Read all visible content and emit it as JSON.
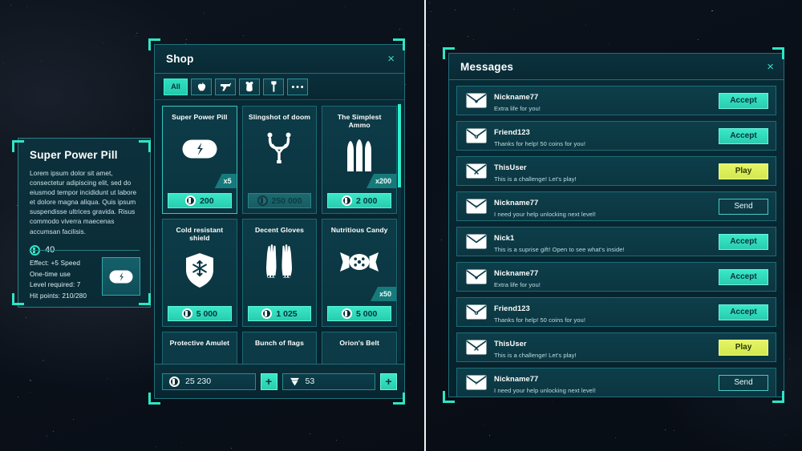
{
  "theme": {
    "accent": "#2ee6c5",
    "accent_dark": "#05343a",
    "panel_bg": "#082b36",
    "border": "#1f7079",
    "play_yellow": "#e4f566",
    "text": "#ffffff"
  },
  "tooltip": {
    "title": "Super Power Pill",
    "description": "Lorem ipsum dolor sit amet, consectetur adipiscing elit, sed do eiusmod tempor incididunt ut labore et dolore magna aliqua. Quis ipsum suspendisse ultrices gravida. Risus commodo viverra maecenas accumsan facilisis.",
    "price": "40",
    "coin_icon": "coin-icon",
    "thumb_icon": "pill-icon",
    "stats": [
      "Effect: +5 Speed",
      "One-time use",
      "Level required: 7",
      "Hit points: 210/280"
    ]
  },
  "shop": {
    "title": "Shop",
    "close_label": "×",
    "tabs": [
      {
        "label": "All",
        "icon": "all-tab",
        "active": true
      },
      {
        "label": "",
        "icon": "apple-icon",
        "active": false
      },
      {
        "label": "",
        "icon": "gun-icon",
        "active": false
      },
      {
        "label": "",
        "icon": "armor-icon",
        "active": false
      },
      {
        "label": "",
        "icon": "axe-icon",
        "active": false
      },
      {
        "label": "",
        "icon": "more-dots-icon",
        "active": false
      }
    ],
    "items": [
      {
        "name": "Super Power Pill",
        "icon": "pill-icon",
        "qty": "x5",
        "price": "200",
        "currency": "coin-icon",
        "affordable": true,
        "selected": true
      },
      {
        "name": "Slingshot of doom",
        "icon": "slingshot-icon",
        "qty": "",
        "price": "250 000",
        "currency": "coin-icon",
        "affordable": false,
        "selected": false
      },
      {
        "name": "The Simplest Ammo",
        "icon": "bullets-icon",
        "qty": "x200",
        "price": "2 000",
        "currency": "coin-icon",
        "affordable": true,
        "selected": false
      },
      {
        "name": "Cold resistant shield",
        "icon": "shield-snowflake-icon",
        "qty": "",
        "price": "5 000",
        "currency": "coin-icon",
        "affordable": true,
        "selected": false
      },
      {
        "name": "Decent Gloves",
        "icon": "gloves-icon",
        "qty": "",
        "price": "1 025",
        "currency": "coin-icon",
        "affordable": true,
        "selected": false
      },
      {
        "name": "Nutritious Candy",
        "icon": "candy-icon",
        "qty": "x50",
        "price": "5 000",
        "currency": "coin-icon",
        "affordable": true,
        "selected": false
      },
      {
        "name": "Protective Amulet",
        "icon": "amulet-icon",
        "qty": "",
        "price": "",
        "currency": "coin-icon",
        "affordable": true,
        "selected": false
      },
      {
        "name": "Bunch of flags",
        "icon": "flags-icon",
        "qty": "",
        "price": "",
        "currency": "coin-icon",
        "affordable": true,
        "selected": false
      },
      {
        "name": "Orion's Belt",
        "icon": "belt-icon",
        "qty": "",
        "price": "",
        "currency": "coin-icon",
        "affordable": true,
        "selected": false
      }
    ],
    "currencies": {
      "coins": "25 230",
      "gems": "53",
      "add_label": "+"
    }
  },
  "messages": {
    "title": "Messages",
    "close_label": "×",
    "rows": [
      {
        "user": "Nickname77",
        "text": "Extra life for you!",
        "envelope": "envelope-heart-icon",
        "action": "Accept",
        "style": "accept"
      },
      {
        "user": "Friend123",
        "text": "Thanks for help! 50 coins for you!",
        "envelope": "envelope-coin-icon",
        "action": "Accept",
        "style": "accept"
      },
      {
        "user": "ThisUser",
        "text": "This is a challenge! Let's play!",
        "envelope": "envelope-swords-icon",
        "action": "Play",
        "style": "play"
      },
      {
        "user": "Nickname77",
        "text": "I need your help unlocking next level!",
        "envelope": "envelope-help-icon",
        "action": "Send",
        "style": "send"
      },
      {
        "user": "Nick1",
        "text": "This is a suprise gift! Open to see what's inside!",
        "envelope": "envelope-icon",
        "action": "Accept",
        "style": "accept"
      },
      {
        "user": "Nickname77",
        "text": "Extra life for you!",
        "envelope": "envelope-heart-icon",
        "action": "Accept",
        "style": "accept"
      },
      {
        "user": "Friend123",
        "text": "Thanks for help! 50 coins for you!",
        "envelope": "envelope-coin-icon",
        "action": "Accept",
        "style": "accept"
      },
      {
        "user": "ThisUser",
        "text": "This is a challenge! Let's play!",
        "envelope": "envelope-swords-icon",
        "action": "Play",
        "style": "play"
      },
      {
        "user": "Nickname77",
        "text": "I need your help unlocking next level!",
        "envelope": "envelope-help-icon",
        "action": "Send",
        "style": "send"
      }
    ]
  }
}
